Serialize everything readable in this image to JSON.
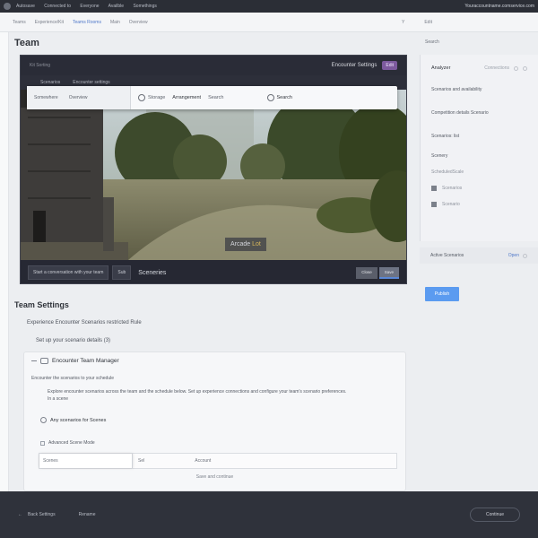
{
  "topbar": {
    "menu": [
      "Autosave",
      "Connected to",
      "Everyone",
      "Availble",
      "Somethings"
    ],
    "right_text": "Youraccountname.comservice.com"
  },
  "navbar": {
    "crumbs": [
      "Teams",
      "Experience/Kit",
      "Teams Rooms",
      "Main",
      "Overview"
    ],
    "right_items": [
      "Y",
      "Edit"
    ]
  },
  "page": {
    "title": "Team",
    "side_note": "Search"
  },
  "preview": {
    "top_left": "Kit Sorting",
    "top_right": "Encounter Settings",
    "badge": "Edit",
    "sub_items": [
      "Scenarios",
      "Encounter settings"
    ],
    "scene_label_prefix": "Arcade",
    "scene_label_highlight": "Lot",
    "bottom_field": "Start a conversation with your team",
    "bottom_tag": "Sub",
    "bottom_label": "Sceneries",
    "bottom_buttons": [
      "Close",
      "Save"
    ]
  },
  "floating_bar": {
    "left_items": [
      "Somewhere",
      "Overview"
    ],
    "item1": "Storage",
    "item2": "Arrangement",
    "item3": "Search",
    "item4": "Search"
  },
  "right_panel": {
    "title": "Analyzer",
    "subtitle": "Connections",
    "rows": [
      "Scenarios and availability",
      "Competition details Scenario",
      "Scenarios: list",
      "Scenery",
      "ScheduledScale",
      "Scenarios",
      "Scenario"
    ],
    "footer_label": "Active Scenarios",
    "footer_link": "Open"
  },
  "blue_button": "Publish",
  "section": {
    "title": "Team Settings",
    "line1": "Experience Encounter Scenarios restricted Rule",
    "line2": "Set up your scenario details (3)"
  },
  "card": {
    "title": "Encounter Team Manager",
    "subtitle": "Encounter the scenarios to your schedule",
    "paragraph": "Explore encounter scenarios across the team and the schedule below. Set up experience connections and configure your team's scenario preferences.",
    "paragraph2": "In a scene",
    "radio_label": "Any scenarios for Scenes",
    "check_label": "Advanced Scene Mode",
    "input_value": "Scenes",
    "col2": "Sel",
    "col3": "Account",
    "footer": "Save and continue"
  },
  "footer": {
    "back": "Back Settings",
    "mid": "Rename",
    "button": "Continue"
  }
}
